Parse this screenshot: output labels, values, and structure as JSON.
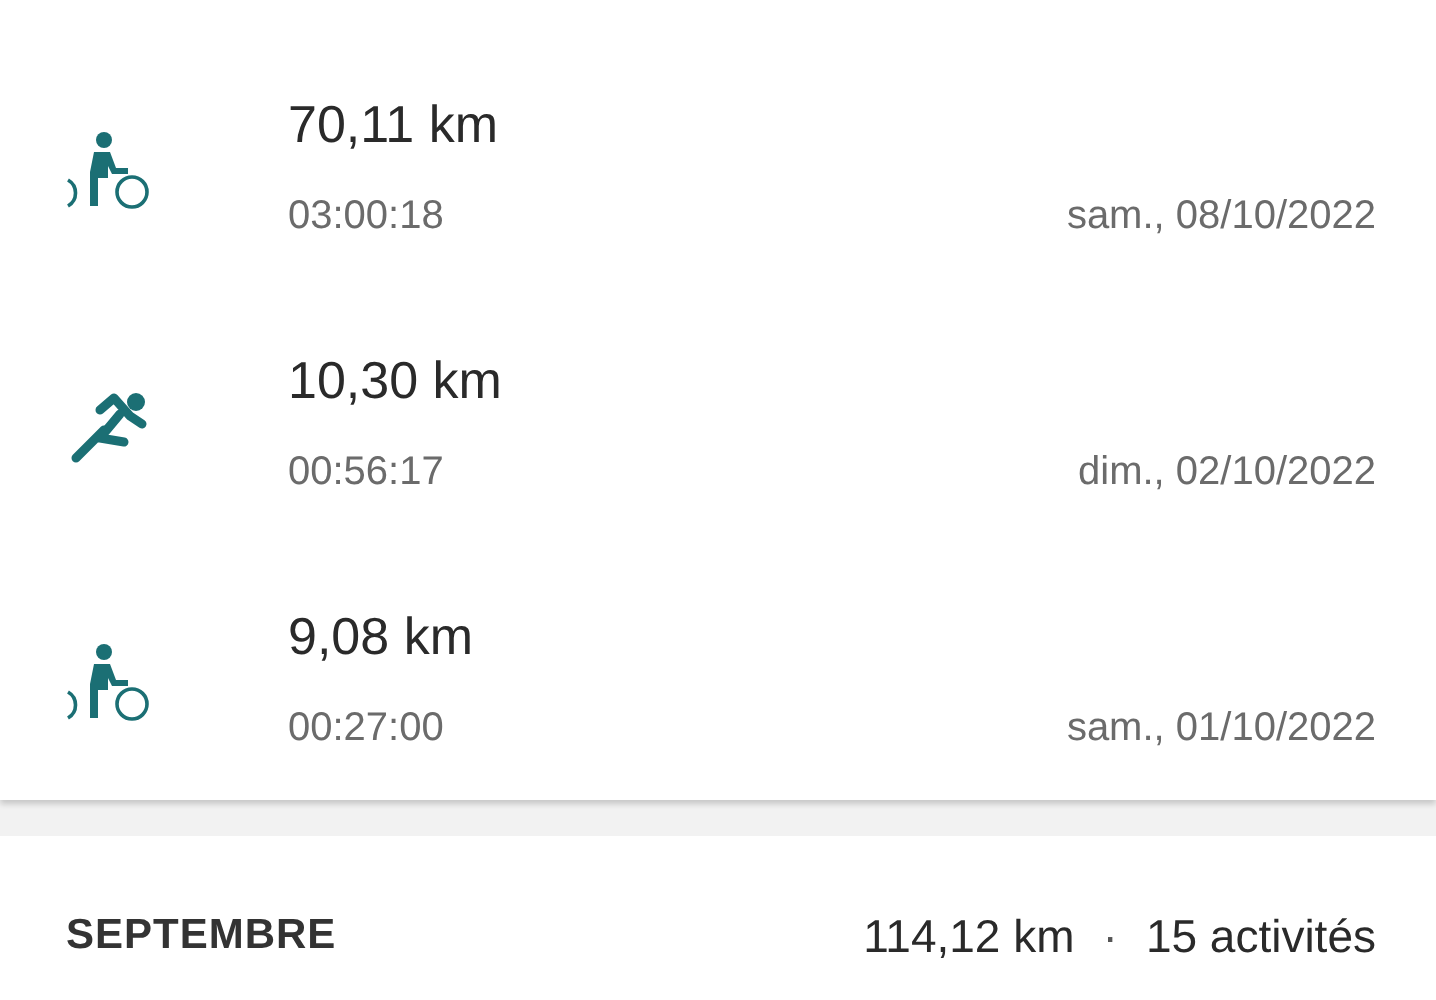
{
  "activities": [
    {
      "kind": "bike",
      "distance": "70,11 km",
      "duration": "03:00:18",
      "date": "sam., 08/10/2022"
    },
    {
      "kind": "run",
      "distance": "10,30 km",
      "duration": "00:56:17",
      "date": "dim., 02/10/2022"
    },
    {
      "kind": "bike",
      "distance": "9,08 km",
      "duration": "00:27:00",
      "date": "sam., 01/10/2022"
    }
  ],
  "month": {
    "title": "SEPTEMBRE",
    "distance": "114,12 km",
    "separator": "·",
    "count": "15 activités"
  }
}
